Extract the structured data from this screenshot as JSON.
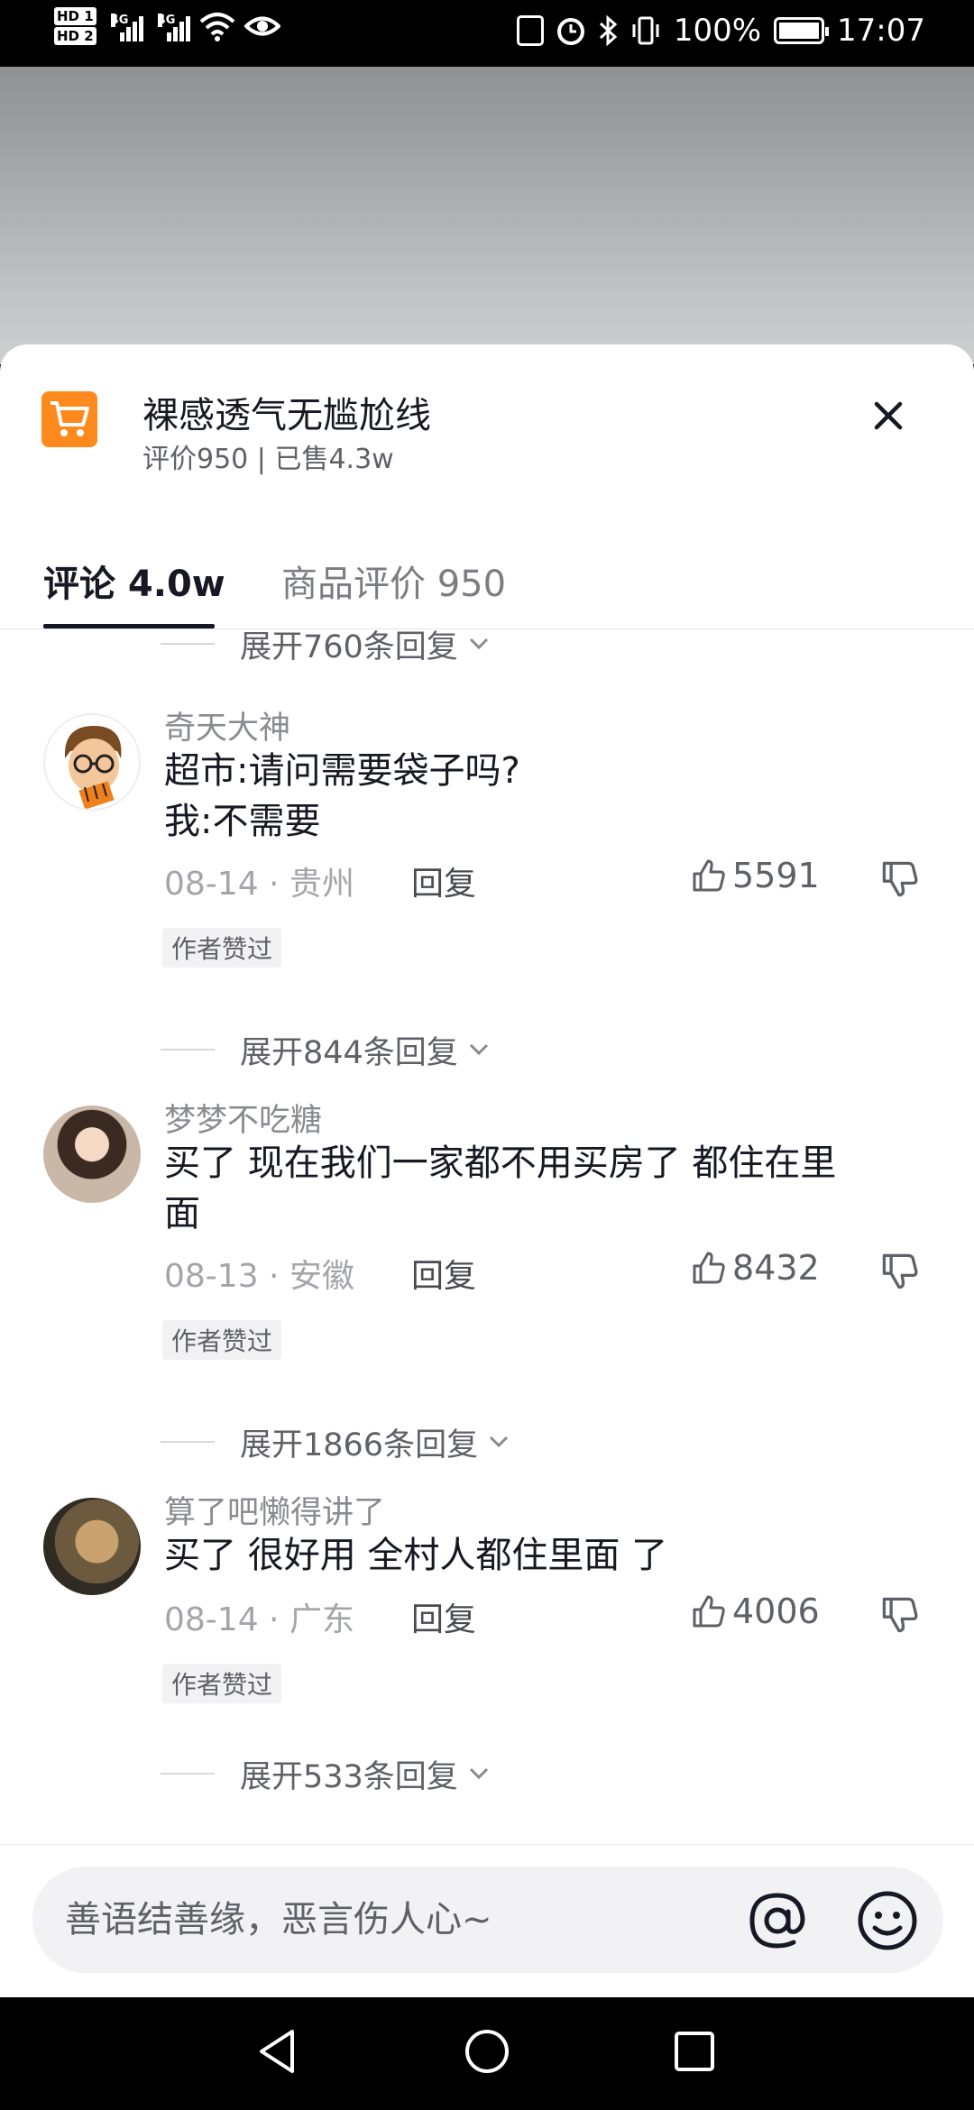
{
  "status_bar": {
    "hd1": "HD 1",
    "hd2": "HD 2",
    "net1": "4G",
    "net2": "4G",
    "battery": "100%",
    "time": "17:07"
  },
  "product": {
    "title": "裸感透气无尴尬线",
    "subtitle": "评价950 | 已售4.3w",
    "icon": "shopping-cart-icon"
  },
  "tabs": [
    {
      "label": "评论 4.0w",
      "active": true
    },
    {
      "label": "商品评价 950",
      "active": false
    }
  ],
  "top_expand": "展开760条回复",
  "comments": [
    {
      "user": "奇天大神",
      "text_lines": [
        "超市:请问需要袋子吗?",
        "我:不需要"
      ],
      "date": "08-14",
      "location": "贵州",
      "reply_label": "回复",
      "likes": "5591",
      "badge": "作者赞过",
      "expand": "展开844条回复"
    },
    {
      "user": "梦梦不吃糖",
      "text_lines": [
        "买了 现在我们一家都不用买房了 都住在里",
        "面"
      ],
      "date": "08-13",
      "location": "安徽",
      "reply_label": "回复",
      "likes": "8432",
      "badge": "作者赞过",
      "expand": "展开1866条回复"
    },
    {
      "user": "算了吧懒得讲了",
      "text_lines": [
        "买了 很好用 全村人都住里面 了"
      ],
      "date": "08-14",
      "location": "广东",
      "reply_label": "回复",
      "likes": "4006",
      "badge": "作者赞过",
      "expand": "展开533条回复"
    }
  ],
  "input": {
    "placeholder": "善语结善缘，恶言伤人心~"
  },
  "colors": {
    "accent_orange": "#fe8a1d",
    "text_primary": "#161823",
    "text_secondary": "#8a8b91"
  }
}
